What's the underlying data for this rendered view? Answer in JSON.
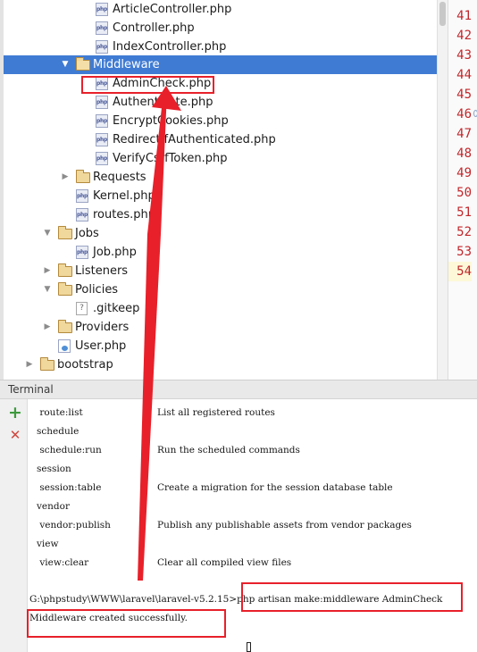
{
  "tree": {
    "rows": [
      {
        "label": "ArticleController.php",
        "icon": "php-file-icon",
        "icon_text": "php"
      },
      {
        "label": "Controller.php",
        "icon": "php-file-icon",
        "icon_text": "php"
      },
      {
        "label": "IndexController.php",
        "icon": "php-file-icon",
        "icon_text": "php"
      },
      {
        "label": "Middleware",
        "icon": "folder-icon",
        "expanded": true,
        "selected": true
      },
      {
        "label": "AdminCheck.php",
        "icon": "php-file-icon",
        "icon_text": "php"
      },
      {
        "label": "Authenticate.php",
        "icon": "php-file-icon",
        "icon_text": "php"
      },
      {
        "label": "EncryptCookies.php",
        "icon": "php-file-icon",
        "icon_text": "php"
      },
      {
        "label": "RedirectIfAuthenticated.php",
        "icon": "php-file-icon",
        "icon_text": "php"
      },
      {
        "label": "VerifyCsrfToken.php",
        "icon": "php-file-icon",
        "icon_text": "php"
      },
      {
        "label": "Requests",
        "icon": "folder-icon",
        "expanded": false
      },
      {
        "label": "Kernel.php",
        "icon": "php-file-icon",
        "icon_text": "php"
      },
      {
        "label": "routes.php",
        "icon": "php-file-icon",
        "icon_text": "php"
      },
      {
        "label": "Jobs",
        "icon": "folder-icon",
        "expanded": true
      },
      {
        "label": "Job.php",
        "icon": "php-file-icon",
        "icon_text": "php"
      },
      {
        "label": "Listeners",
        "icon": "folder-icon",
        "expanded": false
      },
      {
        "label": "Policies",
        "icon": "folder-icon",
        "expanded": true
      },
      {
        "label": ".gitkeep",
        "icon": "text-file-icon",
        "icon_text": "?"
      },
      {
        "label": "Providers",
        "icon": "folder-icon",
        "expanded": false
      },
      {
        "label": "User.php",
        "icon": "user-class-icon",
        "icon_text": ""
      },
      {
        "label": "bootstrap",
        "icon": "folder-icon",
        "expanded": false
      }
    ],
    "arrow_expanded": "▼",
    "arrow_collapsed": "▶"
  },
  "gutter": {
    "line_numbers": [
      "41",
      "42",
      "43",
      "44",
      "45",
      "46",
      "47",
      "48",
      "49",
      "50",
      "51",
      "52",
      "53",
      "54"
    ],
    "current_line": "54"
  },
  "terminal": {
    "title": "Terminal",
    "new_session_glyph": "+",
    "close_session_glyph": "✕",
    "lines": [
      {
        "cmd": " route:list",
        "desc": "List all registered routes"
      },
      {
        "cmd": "schedule",
        "desc": ""
      },
      {
        "cmd": " schedule:run",
        "desc": "Run the scheduled commands"
      },
      {
        "cmd": "session",
        "desc": ""
      },
      {
        "cmd": " session:table",
        "desc": "Create a migration for the session database table"
      },
      {
        "cmd": "vendor",
        "desc": ""
      },
      {
        "cmd": " vendor:publish",
        "desc": "Publish any publishable assets from vendor packages"
      },
      {
        "cmd": "view",
        "desc": ""
      },
      {
        "cmd": " view:clear",
        "desc": "Clear all compiled view files"
      },
      {
        "cmd": "",
        "desc": ""
      },
      {
        "cmd": "G:\\phpstudy\\WWW\\laravel\\laravel-v5.2.15>php artisan make:middleware AdminCheck",
        "desc": ""
      },
      {
        "cmd": "Middleware created successfully.",
        "desc": ""
      }
    ]
  },
  "annotation": {
    "color": "#e8202a"
  }
}
